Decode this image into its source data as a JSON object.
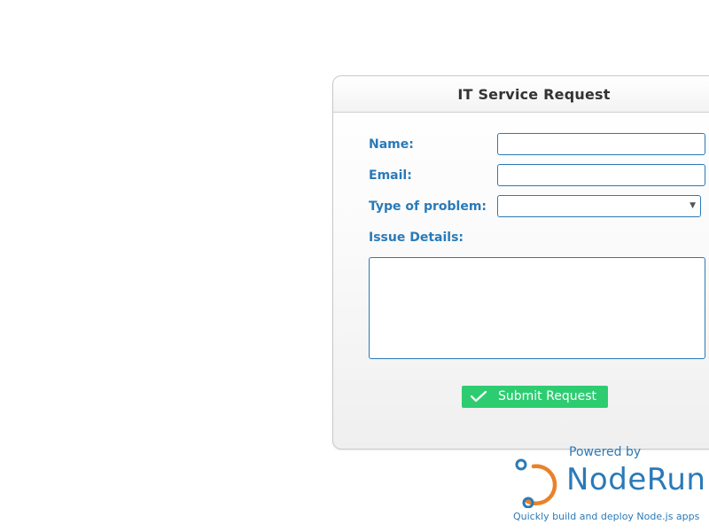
{
  "form": {
    "title": "IT Service Request",
    "name_label": "Name:",
    "name_value": "",
    "email_label": "Email:",
    "email_value": "",
    "problem_label": "Type of problem:",
    "problem_selected": "",
    "details_label": "Issue Details:",
    "details_value": "",
    "submit_label": "Submit Request",
    "submit_icon": "check-icon"
  },
  "branding": {
    "powered_by": "Powered by",
    "name": "NodeRun",
    "tagline": "Quickly build and deploy Node.js apps"
  },
  "colors": {
    "label_blue": "#2a7ab8",
    "button_green": "#2ecc71",
    "logo_orange": "#e8822a",
    "title_text": "#333333"
  }
}
